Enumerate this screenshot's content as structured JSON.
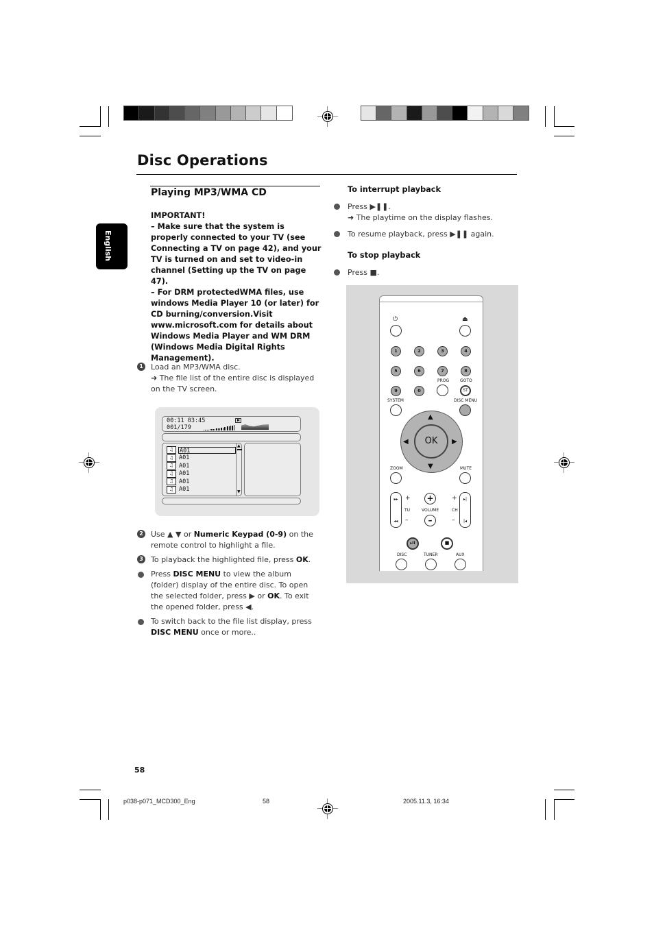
{
  "page": {
    "title": "Disc Operations",
    "side_tab": "English",
    "page_number": "58"
  },
  "print_marks": {
    "left_bar_colors": [
      "#000000",
      "#1a1a1a",
      "#333333",
      "#4d4d4d",
      "#666666",
      "#808080",
      "#999999",
      "#b3b3b3",
      "#cccccc",
      "#e6e6e6",
      "#ffffff"
    ],
    "right_bar_colors": [
      "#e6e6e6",
      "#666666",
      "#b3b3b3",
      "#1a1a1a",
      "#999999",
      "#4d4d4d",
      "#000000",
      "#f2f2f2",
      "#b3b3b3",
      "#d9d9d9",
      "#808080"
    ]
  },
  "left_column": {
    "section_title": "Playing MP3/WMA CD",
    "important_heading": "IMPORTANT!",
    "important_lines": [
      "–  Make sure that the system is properly connected to your TV (see Connecting a TV on page 42), and your TV is turned on and set to video-in channel (Setting up the TV on page 47).",
      "–  For DRM  protectedWMA files, use windows Media Player 10 (or later) for CD burning/conversion.Visit www.microsoft.com for details about Windows Media Player and WM DRM (Windows Media Digital Rights Management)."
    ],
    "step1": {
      "number": "1",
      "text": "Load an MP3/WMA disc.",
      "result": "➜ The file list of the entire disc is displayed on the TV screen."
    },
    "step2": {
      "number": "2",
      "pre": "Use ▲ ▼ or ",
      "bold": "Numeric Keypad (0-9)",
      "post": " on the remote control to highlight a file."
    },
    "step3": {
      "number": "3",
      "pre": "To playback the highlighted file, press ",
      "bold": "OK",
      "post": "."
    },
    "bullet1": {
      "pre": "Press ",
      "bold1": "DISC MENU",
      "mid": " to view the album (folder) display of the entire disc. To open the selected folder, press ▶  or ",
      "bold2": "OK",
      "post": ". To exit the opened folder, press ◀."
    },
    "bullet2": {
      "pre": "To switch back to the file list display, press ",
      "bold": "DISC MENU",
      "post": " once or more.."
    }
  },
  "tv_screen": {
    "elapsed": "00:11",
    "total": "03:45",
    "track": "001/179",
    "play_icon": "play-icon",
    "files": [
      "A01",
      "A01",
      "A01",
      "A01",
      "A01",
      "A01"
    ]
  },
  "right_column": {
    "interrupt_heading": "To interrupt playback",
    "interrupt_press": "Press  ▶❚❚.",
    "interrupt_result": "➜ The playtime on the display flashes.",
    "resume": "To resume playback, press  ▶❚❚ again.",
    "stop_heading": "To stop playback",
    "stop_press": "Press ■."
  },
  "remote": {
    "power_icon": "⏻",
    "eject_icon": "⏏",
    "numbers": [
      "1",
      "2",
      "3",
      "4",
      "5",
      "6",
      "7",
      "8",
      "9",
      "0"
    ],
    "labels": {
      "prog": "PROG",
      "goto": "GOTO",
      "st": "ST",
      "system": "SYSTEM",
      "disc_menu": "DISC MENU",
      "ok": "OK",
      "zoom": "ZOOM",
      "mute": "MUTE",
      "tu": "TU",
      "volume": "VOLUME",
      "ch": "CH",
      "plus": "+",
      "minus": "–",
      "disc": "DISC",
      "tuner": "TUNER",
      "aux": "AUX",
      "ffwd": "▸▸",
      "rew": "◂◂",
      "next": "▸|",
      "prev": "|◂",
      "play_pause": "▸II",
      "stop": "■",
      "up": "▲",
      "down": "▼",
      "left": "◀",
      "right": "▶"
    }
  },
  "footer": {
    "file": "p038-p071_MCD300_Eng",
    "page": "58",
    "datetime": "2005.11.3, 16:34"
  }
}
